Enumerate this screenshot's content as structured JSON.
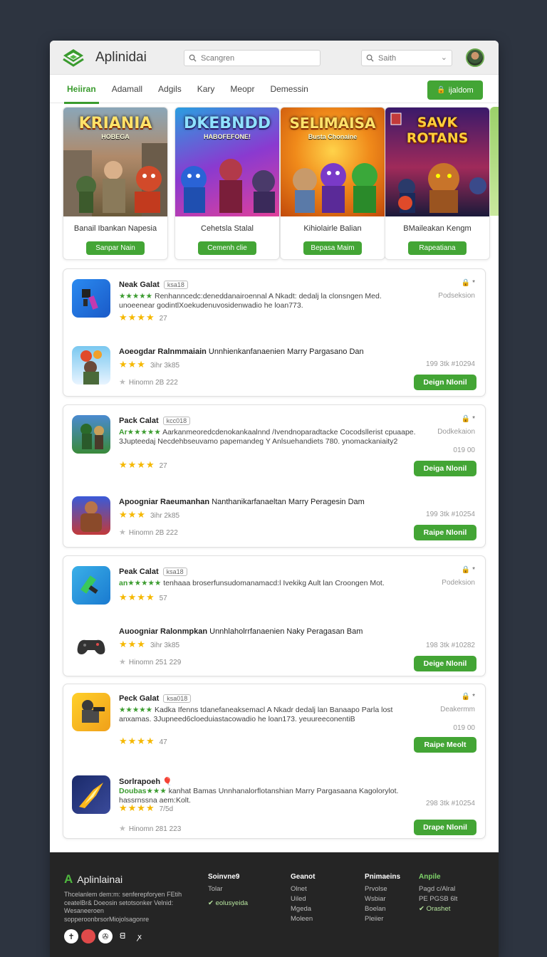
{
  "header": {
    "app_name": "Aplinidai",
    "search_placeholder": "Scangren",
    "search2_placeholder": "Saith"
  },
  "nav": {
    "items": [
      "Heiiran",
      "Adamall",
      "Adgils",
      "Kary",
      "Meopr",
      "Demessin"
    ],
    "signin_label": "ijaldom"
  },
  "featured": [
    {
      "art_title": "KRIANIA",
      "art_sub": "HOBEGA",
      "name": "Banail Ibankan Napesia",
      "button": "Sanpar Nain"
    },
    {
      "art_title": "DKEBNDD",
      "art_sub": "HABOFEFONE!",
      "name": "Cehetsla Stalal",
      "button": "Cemenh clie"
    },
    {
      "art_title": "SELIMAISA",
      "art_sub": "Busta Chonaine",
      "name": "Kihiolairle Balian",
      "button": "Bepasa Maim"
    },
    {
      "art_title": "SAVK ROTANS",
      "art_sub": "",
      "name": "BMaileakan Kengm",
      "button": "Rapeatiana"
    }
  ],
  "cards": [
    {
      "rows": [
        {
          "title": "Neak Galat",
          "tag": "ksa18",
          "desc_prefix": "★★★★★",
          "desc": "Renhanncedc:deneddanairoennal A Nkadt: dedalj la clonsngen Med. unoeenear godintlXoekudenuvosidenwadio he loan773.",
          "rating": "★★★★",
          "rating_num": "27",
          "right_lock": "🔒 *",
          "right_text": "Podseksion"
        },
        {
          "title": "Aoeogdar Ralnmmaiain",
          "title_rest": "Unnhienkanfanaenien Marry Pargasano Dan",
          "rating": "★★★",
          "rating_num": "3ihr 3k85",
          "meta": "Hinomn 2B 222",
          "right_text": "199  3tk  #10294",
          "button": "Deign Nlonil"
        }
      ]
    },
    {
      "rows": [
        {
          "title": "Pack Calat",
          "tag": "kcc018",
          "desc_prefix": "Ar★★★★★",
          "desc": "Aarkanmeoredcdenokankaalnnd /Ivendnoparadtacke Cocodsllerist cpuaape. 3Jupteedaj Necdehbseuvamo papemandeg Y Anlsuehandiets 780. ynomackaniaity2",
          "rating": "★★★★",
          "rating_num": "27",
          "right_lock": "🔒 *",
          "right_text": "Dodkekaion",
          "right_text2": "019 00",
          "button": "Deiga Nlonil"
        },
        {
          "title": "Apoogniar Raeumanhan",
          "title_rest": "Nanthanikarfanaeltan Marry Peragesin Dam",
          "rating": "★★★",
          "rating_num": "3ihr 2k85",
          "meta": "Hinomn 2B 222",
          "right_text": "199  3tk  #10254",
          "button": "Raipe Nlonil"
        }
      ]
    },
    {
      "rows": [
        {
          "title": "Peak Calat",
          "tag": "ksa18",
          "desc_prefix": "an★★★★★",
          "desc": "tenhaaa broserfunsudomanamacd:l Ivekikg Ault lan Croongen Mot.",
          "rating": "★★★★",
          "rating_num": "57",
          "right_lock": "🔒 *",
          "right_text": "Podeksion"
        },
        {
          "title": "Auoogniar Ralonmpkan",
          "title_rest": "Unnhlaholrrfanaenien Naky Peragasan Bam",
          "rating": "★★★",
          "rating_num": "3ihr 3k85",
          "meta": "Hinomn 251 229",
          "right_text": "198  3tk  #10282",
          "button": "Deige Nlonil"
        }
      ]
    },
    {
      "rows": [
        {
          "title": "Peck Galat",
          "tag": "ksa018",
          "desc_prefix": "★★★★★",
          "desc": "Kadka Ifenns tdanefaneaksemacl A Nkadr dedalj lan Banaapo Parla lost anxamas. 3Jupneed6cloeduiastacowadio he loan173. yeuureeconentiB",
          "rating": "★★★★",
          "rating_num": "47",
          "right_lock": "🔒 *",
          "right_text": "Deakermm",
          "right_text2": "019 00",
          "button": "Raipe Meolt"
        },
        {
          "title": "Sorlrapoeh",
          "title_icon": "🎈",
          "desc_prefix": "Doubas★★★",
          "desc": "kanhat Bamas Unnhanalorflotanshian Marry Pargasaana Kagolorylot. hassrnssna aem:Kolt.",
          "rating": "★★★★",
          "rating_num": "7/5d",
          "meta": "Hinomn 281 223",
          "right_text": "298  3tk  #10254",
          "button": "Drape Nlonil"
        }
      ]
    }
  ],
  "footer": {
    "brand": "Aplinlainai",
    "about": "Thcelanlem dem:m: senferepforyen FEtih ceatelBr& Doeosin setotsonker Velnid: Wesaneeroen sopperoonbrsorMiojolsagonre",
    "columns": [
      {
        "heading": "Soinvne9",
        "items": [
          "Tolar"
        ],
        "green_item": "✔ eolusyeida"
      },
      {
        "heading": "Geanot",
        "items": [
          "Olnet",
          "Uiled",
          "Mgeda",
          "Moleen"
        ]
      },
      {
        "heading": "Pnimaeins",
        "items": [
          "Prvolse",
          "Wsbiar",
          "Boelan",
          "Pleiier"
        ]
      },
      {
        "heading": "Anpile",
        "items": [
          "Pagd c/Alral",
          "PE PGSB 6lt"
        ],
        "green_item": "✔ Orashet"
      }
    ],
    "socials": [
      "✝",
      "●",
      "✇",
      "ᗺ",
      "ꭗ"
    ]
  },
  "colors": {
    "accent": "#43a535",
    "star": "#f5b800",
    "footer_bg": "#252525",
    "page_bg": "#2d3440"
  }
}
